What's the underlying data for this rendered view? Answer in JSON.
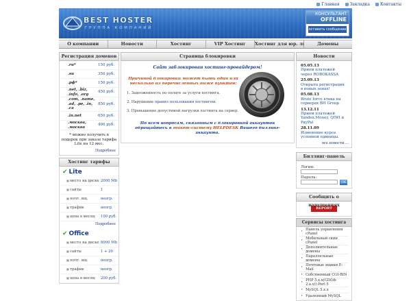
{
  "topbar": {
    "links": [
      "Главная",
      "Закладка",
      "Контакты"
    ]
  },
  "header": {
    "logo_text": "BEST HOSTER",
    "logo_sub": "ГРУППА КОМПАНИЙ",
    "consult": {
      "line1": "КОНСУЛЬТАНТ",
      "line2": "OFFLINE",
      "button": "оставить сообщение"
    }
  },
  "nav": {
    "items": [
      "О компании",
      "Новости",
      "Хостинг",
      "VIP Хостинг",
      "Хостинг для юр. лиц",
      "Домены"
    ]
  },
  "domains": {
    "title": "Регистрация доменов",
    "rows": [
      {
        "name": ".ru*",
        "price": "150 руб."
      },
      {
        "name": ".su",
        "price": "350 руб."
      },
      {
        "name": ".рф*",
        "price": "150 руб."
      },
      {
        "name": ".net, .biz, .info, .org",
        "price": "450 руб."
      },
      {
        "name": ".com, .name, .ad, .pe, .in, .ca",
        "price": "850 руб."
      },
      {
        "name": ".in.net",
        "price": "650 руб."
      },
      {
        "name": ".москва, .москва",
        "price": "400 руб."
      }
    ],
    "note": "* можно получить в подарок при заказе тарифа Lite на 12 мес.",
    "more": "Подробнее"
  },
  "plans": {
    "title": "Хостинг тарифы",
    "lite": {
      "name": "Lite",
      "rows": [
        {
          "k": "место на диске",
          "v": "2000 Mb"
        },
        {
          "k": "сайты",
          "v": "1"
        },
        {
          "k": "почт. ящ.",
          "v": "неогр."
        },
        {
          "k": "трафик",
          "v": "неогр."
        },
        {
          "k": "цена в месяц",
          "v": "100 руб."
        }
      ],
      "more": "Подробнее"
    },
    "office": {
      "name": "Office",
      "rows": [
        {
          "k": "место на диске",
          "v": "8000 Mb"
        },
        {
          "k": "сайты",
          "v": "1 + 20"
        },
        {
          "k": "почт. ящ.",
          "v": "неогр."
        },
        {
          "k": "трафик",
          "v": "неогр."
        },
        {
          "k": "цена в месяц",
          "v": "200 руб."
        }
      ]
    }
  },
  "main": {
    "title": "Страница блокировки",
    "heading": "Сайт заблокирован хостинг-провайдером!",
    "reason": "Причиной блокировки может быть один или несколько из перечисленных ниже пунктов:",
    "items": [
      {
        "pre": "1. Задолженность по оплате за услуги хостинга.",
        "link": ""
      },
      {
        "pre": "2. Нарушение ",
        "link": "правил пользования хостингом."
      },
      {
        "pre": "3. Превышение допустимой нагрузки хостинга на сервер.",
        "link": ""
      }
    ],
    "footer_pre": "По всем вопросам, связанным с блокировкой аккаунтов обращайтесь в ",
    "footer_link": "тикет-систему HELPDESK",
    "footer_post": " Вашего биллинг-аккаунта."
  },
  "news": {
    "title": "Новости",
    "items": [
      {
        "date": "05.05.13",
        "text": "Прием платежей через ROBOKASSA"
      },
      {
        "date": "25.09.13",
        "text": "Открыта регистрация в новых зонах!"
      },
      {
        "date": "05.08.13",
        "text": "Brute force атака на серверах BH Group"
      },
      {
        "date": "13.12.11",
        "text": "Прием платежей Yandex.Money, QIWI и PayPal"
      },
      {
        "date": "28.11.09",
        "text": "Изменение курса условной единицы."
      }
    ],
    "more": "все новости ..."
  },
  "billing": {
    "title": "Биллинг-панель",
    "login_label": "Логин:",
    "password_label": "Пароль:",
    "ok": "ОК"
  },
  "report": {
    "title": "Сообщить о нарушениях",
    "button": "REPORT SPAM"
  },
  "services": {
    "title": "Сервисы хостинга",
    "items": [
      "Панель управления cPanel",
      "Мобильный скин cPanel",
      "Дополнительные домены",
      "Параллельные домены",
      "Почтовые ящики E-Mail",
      "Собственный CGI-BIN",
      "PHP 5.x.x(GD(lib 2.x.x)):Perl 5",
      "MySQL 5.x.x",
      "Удаленный MySQL"
    ]
  }
}
